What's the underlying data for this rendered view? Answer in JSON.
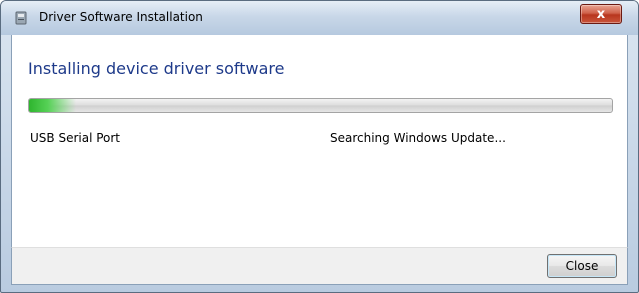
{
  "window": {
    "title": "Driver Software Installation",
    "close_glyph": "x"
  },
  "main": {
    "heading": "Installing device driver software",
    "progress_fraction": 0.08,
    "device_name": "USB Serial Port",
    "status_text": "Searching Windows Update..."
  },
  "footer": {
    "close_label": "Close"
  },
  "colors": {
    "heading": "#1e3a8a",
    "progress": "#2fb52f"
  },
  "icons": {
    "title": "driver-install-icon",
    "close": "close-icon"
  }
}
